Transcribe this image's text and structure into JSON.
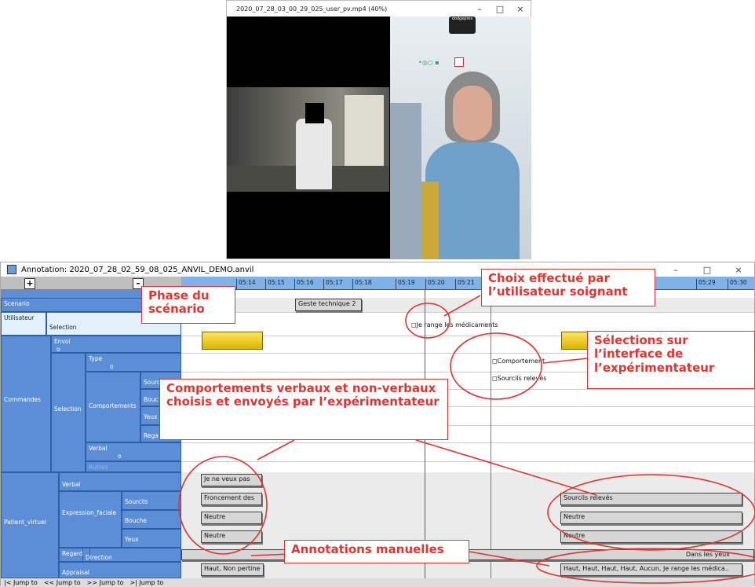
{
  "video_window": {
    "title": "2020_07_28_03_00_29_025_user_pv.mp4 (40%)",
    "controls": [
      "–",
      "□",
      "×"
    ],
    "overlay_label": "dodgepres"
  },
  "anvil": {
    "title": "Annotation: 2020_07_28_02_59_08_025_ANVIL_DEMO.anvil",
    "controls": [
      "–",
      "□",
      "×"
    ],
    "zoom_in": "+",
    "zoom_out": "–",
    "ticks": [
      "05:14",
      "05:15",
      "05:16",
      "05:17",
      "05:18",
      "05:19",
      "05:20",
      "05:21",
      "05:29",
      "05:30"
    ],
    "labels": {
      "scenario": "Scenario",
      "utilisateur": "Utilisateur",
      "selection_u": "Selection",
      "commandes": "Commandes",
      "envoi": "Envoi",
      "envoi_o": "o",
      "selection_c": "Selection",
      "type": "Type",
      "type_o": "o",
      "comportements": "Comportements",
      "sourcils": "Sourcils",
      "bouche": "Bouc",
      "yeux": "Yeux",
      "regard": "Rega",
      "verbal": "Verbal",
      "verbal_o": "o",
      "autres": "Autres",
      "patient": "Patient_virtuel",
      "p_verbal": "Verbal",
      "expression": "Expression_faciale",
      "p_sourcils": "Sourcils",
      "p_bouche": "Bouche",
      "p_yeux": "Yeux",
      "p_regard": "Regard",
      "direction": "Direction",
      "appraisal": "Appraisal"
    },
    "elements": {
      "geste": "Geste technique 2",
      "je_range": "Je range les médicaments",
      "comportement": "Comportement",
      "sourcils_releves_c": "Sourcils relevés",
      "je_ne_veux": "Je ne veux pas",
      "froncement": "Froncement des",
      "neutre1": "Neutre",
      "neutre2": "Neutre",
      "sourcils_releves_p": "Sourcils relevés",
      "neutre3": "Neutre",
      "neutre4": "Neutre",
      "dans_les_yeux": "Dans les yeux",
      "haut_non": "Haut, Non pertine",
      "haut_haut": "Haut, Haut, Haut, Haut, Aucun, Je range les médica.."
    },
    "jump_buttons": [
      "|< Jump to",
      "<< Jump to",
      ">> Jump to",
      ">| Jump to"
    ]
  },
  "callouts": {
    "phase": "Phase du scénario",
    "choix": "Choix effectué par l’utilisateur soignant",
    "selections": "Sélections sur l’interface de l’expérimentateur",
    "comportements": "Comportements verbaux et non-verbaux choisis et envoyés par l’expérimentateur",
    "annotations": "Annotations manuelles"
  },
  "colors": {
    "callout": "#e3342f",
    "label_blue": "#5b8ed6",
    "timeline": "#7fb2e8",
    "yellow": "#f0cf20"
  }
}
